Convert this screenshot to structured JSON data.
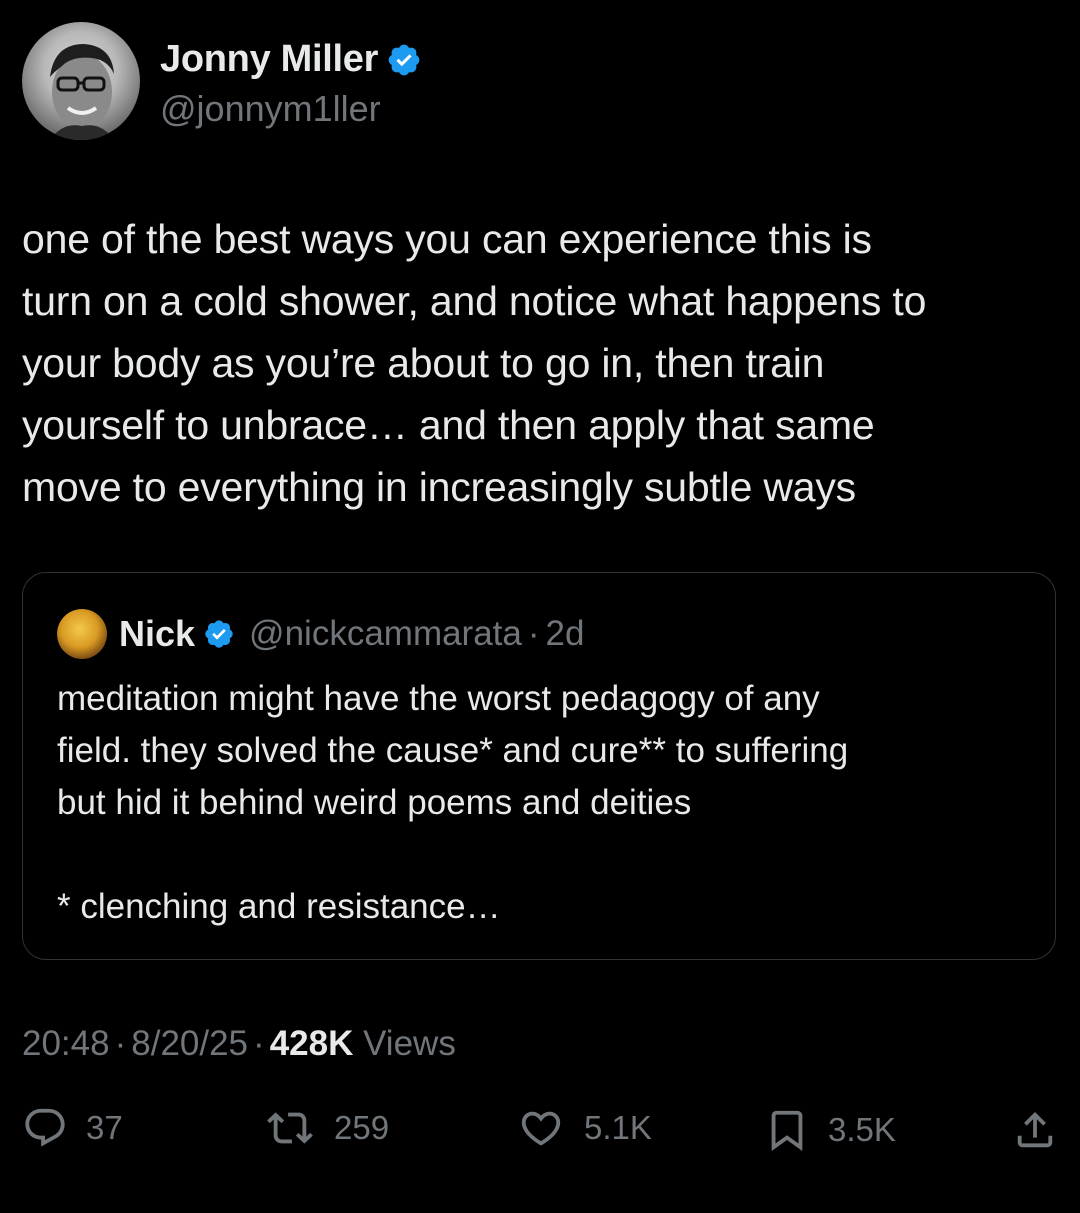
{
  "author": {
    "display_name": "Jonny Miller",
    "handle": "@jonnym1ller",
    "verified": true,
    "avatar_icon": "profile-photo"
  },
  "tweet": {
    "text_lines": [
      "one of the best ways you can experience this is",
      "turn on a cold shower, and notice what happens to",
      "your body as you’re about to go in, then train",
      "yourself to unbrace… and then apply that same",
      "move to everything in increasingly subtle ways"
    ]
  },
  "quoted_tweet": {
    "display_name": "Nick",
    "handle": "@nickcammarata",
    "separator": "·",
    "age": "2d",
    "verified": true,
    "text_lines": [
      "meditation might have the worst pedagogy of any",
      "field. they solved the cause* and cure** to suffering",
      "but hid it behind weird poems and deities"
    ],
    "footnote": "* clenching and resistance…"
  },
  "meta": {
    "time": "20:48",
    "separator": "·",
    "date": "8/20/25",
    "views_count": "428K",
    "views_label": "Views"
  },
  "actions": {
    "replies": "37",
    "reposts": "259",
    "likes": "5.1K",
    "bookmarks": "3.5K"
  },
  "colors": {
    "background": "#000000",
    "text_primary": "#e7e9ea",
    "text_secondary": "#71767b",
    "verified_blue": "#1d9bf0",
    "border": "#2f3336"
  }
}
